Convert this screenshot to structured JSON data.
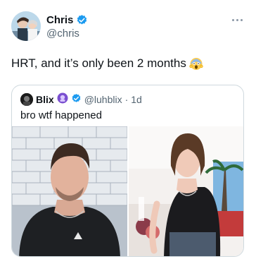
{
  "post": {
    "author_name": "Chris",
    "author_handle": "@chris",
    "text": "HRT, and it’s only been 2 months",
    "emoji": "scream-emoji"
  },
  "quote": {
    "author_name": "Blix",
    "author_handle": "@luhblix",
    "separator": "·",
    "age": "1d",
    "text": "bro wtf happened"
  },
  "icons": {
    "verified": "verified-badge-icon",
    "more": "more-options-icon",
    "affiliate": "affiliate-badge-icon"
  },
  "colors": {
    "verified_blue": "#1d9bf0",
    "muted": "#536471",
    "border": "#cfd9de"
  }
}
